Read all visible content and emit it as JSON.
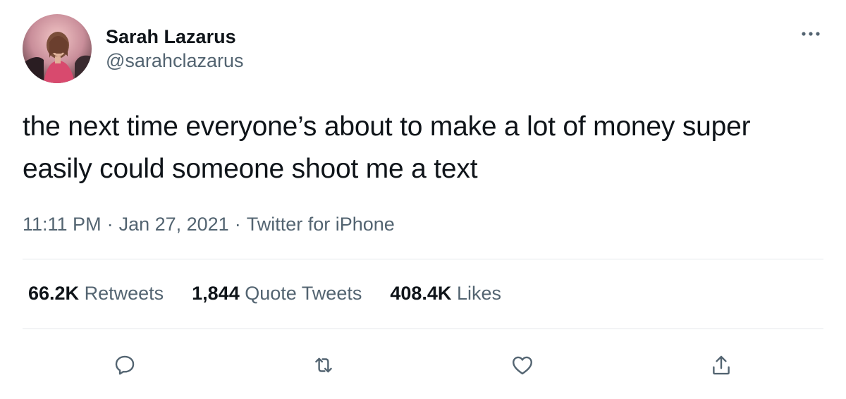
{
  "author": {
    "display_name": "Sarah Lazarus",
    "handle": "@sarahclazarus"
  },
  "tweet": {
    "text": "the next time everyone’s about to make a lot of money super easily could someone shoot me a text"
  },
  "meta": {
    "time": "11:11 PM",
    "separator": "·",
    "date": "Jan 27, 2021",
    "source": "Twitter for iPhone"
  },
  "stats": {
    "retweets": {
      "count": "66.2K",
      "label": "Retweets"
    },
    "quotes": {
      "count": "1,844",
      "label": "Quote Tweets"
    },
    "likes": {
      "count": "408.4K",
      "label": "Likes"
    }
  },
  "icons": {
    "more": "more-horizontal-icon",
    "reply": "reply-icon",
    "retweet": "retweet-icon",
    "like": "heart-icon",
    "share": "share-icon"
  },
  "colors": {
    "text_primary": "#0f1419",
    "text_secondary": "#536471",
    "divider": "#e5e8eb"
  }
}
